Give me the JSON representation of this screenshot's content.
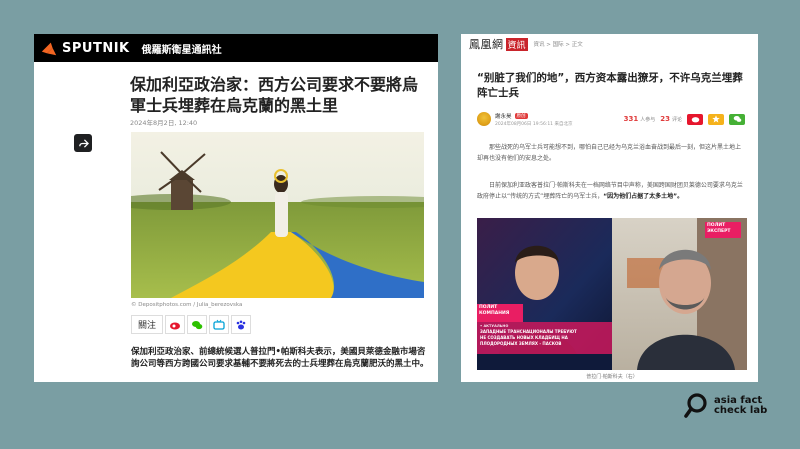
{
  "sputnik": {
    "logo_text": "SPUTNIK",
    "tagline": "俄羅斯衛星通訊社",
    "title": "保加利亞政治家：西方公司要求不要將烏軍士兵埋葬在烏克蘭的黑土里",
    "date": "2024年8月2日, 12:40",
    "photo_caption": "© Depositphotos.com / Julia_berezovska",
    "follow_label": "關注",
    "share_buttons": [
      "weibo-icon",
      "wechat-icon",
      "tv-icon",
      "paw-icon"
    ],
    "body": "保加利亞政治家、前總統候選人普拉門•帕斯科夫表示，美國貝萊德金融市場咨詢公司等西方跨國公司要求基輔不要將死去的士兵埋葬在烏克蘭肥沃的黑土中。"
  },
  "phoenix": {
    "logo_text": "鳳凰網",
    "logo_badge": "資訊",
    "breadcrumb": "資讯 > 国际 > 正文",
    "title": "“别脏了我们的地”，西方资本露出獠牙，不许乌克兰埋葬阵亡士兵",
    "author": "謝永昊",
    "author_tag": "原创",
    "time": "2024年08月06日 19:56:11 来自北京",
    "participants_count": "331",
    "participants_label": "人参与",
    "comments_count": "23",
    "comments_label": "评论",
    "para1": "那些战死的乌军士兵可能想不到，哪怕自己已经为乌克兰浴血奋战到最后一刻，但这片黑土地上却再也没有他们的安息之处。",
    "para2_normal": "日前保加利亚政客普拉门·帕斯科夫在一档网络节目中声称，美国跨国财团贝莱德公司要求乌克兰政府停止以“传统的方式”埋葬阵亡的乌军士兵，",
    "para2_bold": "“因为他们占据了太多土地”。",
    "video_caption": "普拉门·帕斯科夫（右）",
    "video": {
      "logo_right_line1": "ПОЛИТ",
      "logo_right_line2": "ЭКСПЕРТ",
      "logo_left_line1": "ПОЛИТ",
      "logo_left_line2": "КОМПАНИЯ",
      "ticker_top": "• АКТУАЛЬНО",
      "ticker_line1": "ЗАПАДНЫЕ ТРАНСНАЦИОНАЛЫ ТРЕБУЮТ",
      "ticker_line2": "НЕ СОЗДАВАТЬ НОВЫХ КЛАДБИЩ НА",
      "ticker_line3": "ПЛОДОРОДНЫХ ЗЕМЛЯХ - ПАСКОВ"
    }
  },
  "watermark": {
    "line1": "asia fact",
    "line2": "check lab"
  },
  "colors": {
    "background": "#7a9ea3",
    "sputnik_orange": "#f26522",
    "phoenix_red": "#c9242b"
  }
}
